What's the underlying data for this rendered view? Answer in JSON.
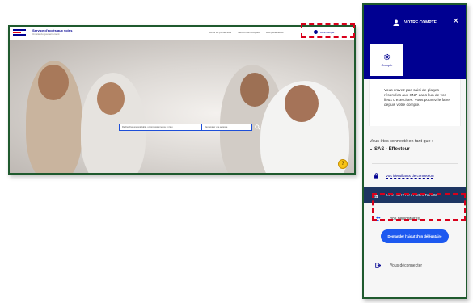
{
  "site": {
    "brand_title": "Service d'accès aux soins",
    "brand_subtitle": "Un site du gouvernement",
    "top_links": [
      "Accès au portail SAS",
      "Gestion de comptes",
      "Mes paramètres"
    ],
    "account_label": "votre compte",
    "search_what_placeholder": "Rechercher une spécialité, un professionnel ou un lieu",
    "search_where_placeholder": "Renseigner une adresse",
    "help_label": "?"
  },
  "panel": {
    "title": "VOTRE COMPTE",
    "close_label": "✕",
    "tab_label": "Compte",
    "info_text": "Vous n'avez pas saisi de plages réservées aux SNP dans l'un de vos lieux d'exercices. Vous pouvez le faire depuis votre compte.",
    "connected_label": "Vous êtes connecté en tant que :",
    "role": "SAS - Effecteur",
    "menu_identifiers": "Vos identifiants de connexion",
    "menu_lieux": "VOS LIEUX DE CONSULTATION",
    "menu_delegataires": "Vos délégataires",
    "add_delegate_button": "Demander l'ajout d'un délégataire",
    "menu_logout": "Vous déconnecter"
  },
  "colors": {
    "primary_blue": "#000091",
    "menu_active": "#1d3562",
    "button_blue": "#1d59f0",
    "highlight_red": "#d8001b",
    "help_yellow": "#f7c417"
  }
}
